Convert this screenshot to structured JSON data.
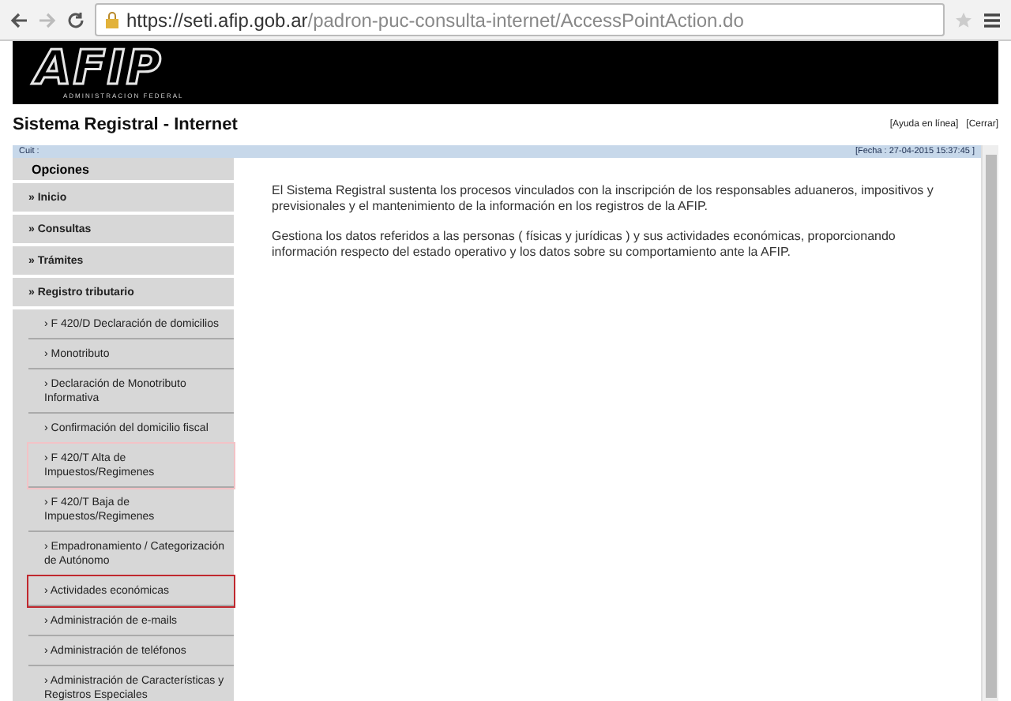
{
  "browser": {
    "url_host": "https://seti.afip.gob.ar",
    "url_path": "/padron-puc-consulta-internet/AccessPointAction.do"
  },
  "banner": {
    "logo": "AFIP",
    "subtitle": "ADMINISTRACION FEDERAL"
  },
  "header": {
    "title": "Sistema Registral - Internet",
    "links": [
      "[Ayuda en línea]",
      "[Cerrar]"
    ]
  },
  "info_bar": {
    "left": "Cuit :",
    "right": "[Fecha : 27-04-2015 15:37:45 ]"
  },
  "sidebar": {
    "title": "Opciones",
    "items": [
      {
        "label": "» Inicio",
        "kind": "section"
      },
      {
        "label": "» Consultas",
        "kind": "section"
      },
      {
        "label": "» Trámites",
        "kind": "section"
      },
      {
        "label": "» Registro tributario",
        "kind": "section"
      },
      {
        "label": "› F 420/D Declaración de domicilios",
        "kind": "sub"
      },
      {
        "label": "› Monotributo",
        "kind": "sub"
      },
      {
        "label": "› Declaración de Monotributo Informativa",
        "kind": "sub"
      },
      {
        "label": "› Confirmación del domicilio fiscal",
        "kind": "sub"
      },
      {
        "label": "› F 420/T Alta de Impuestos/Regimenes",
        "kind": "sub",
        "color": "#f3c2c6"
      },
      {
        "label": "› F 420/T Baja de Impuestos/Regimenes",
        "kind": "sub"
      },
      {
        "label": "› Empadronamiento / Categorización de Autónomo",
        "kind": "sub"
      },
      {
        "label": "› Actividades económicas",
        "kind": "sub",
        "color": "#c0282e"
      },
      {
        "label": "› Administración de e-mails",
        "kind": "sub"
      },
      {
        "label": "› Administración de teléfonos",
        "kind": "sub"
      },
      {
        "label": "› Administración de Características y Registros Especiales",
        "kind": "sub"
      }
    ]
  },
  "content": {
    "paragraphs": [
      "El Sistema Registral sustenta los procesos vinculados con la inscripción de los responsables aduaneros, impositivos y previsionales y el mantenimiento de la información en los registros de la AFIP.",
      "Gestiona los datos referidos a las personas ( físicas y jurídicas ) y sus actividades económicas, proporcionando información respecto del estado operativo y los datos sobre su comportamiento ante la AFIP."
    ]
  }
}
